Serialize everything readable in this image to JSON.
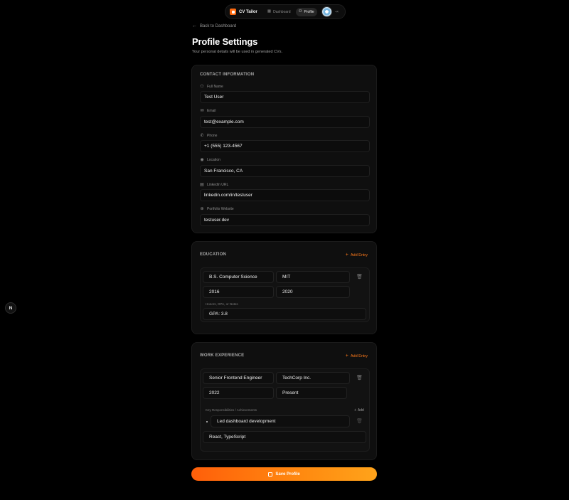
{
  "nav": {
    "brand": "CV Tailor",
    "items": [
      {
        "label": "Dashboard",
        "icon": "grid-icon",
        "active": false
      },
      {
        "label": "Profile",
        "icon": "user-icon",
        "active": true
      }
    ],
    "logout_glyph": "⇥"
  },
  "side_badge": {
    "letter": "N"
  },
  "header": {
    "back": "Back to Dashboard",
    "title": "Profile Settings",
    "subtitle": "Your personal details will be used in generated CVs."
  },
  "contact": {
    "title": "CONTACT INFORMATION",
    "fields": [
      {
        "label": "Full Name",
        "value": "Test User",
        "icon": "user-icon"
      },
      {
        "label": "Email",
        "value": "test@example.com",
        "icon": "mail-icon"
      },
      {
        "label": "Phone",
        "value": "+1 (555) 123-4567",
        "icon": "phone-icon"
      },
      {
        "label": "Location",
        "value": "San Francisco, CA",
        "icon": "map-pin-icon"
      },
      {
        "label": "LinkedIn URL",
        "value": "linkedin.com/in/testuser",
        "icon": "briefcase-icon"
      },
      {
        "label": "Portfolio Website",
        "value": "testuser.dev",
        "icon": "globe-icon"
      }
    ]
  },
  "education": {
    "title": "EDUCATION",
    "add_label": "Add Entry",
    "entry": {
      "degree": "B.S. Computer Science",
      "school": "MIT",
      "start": "2016",
      "end": "2020",
      "notes_label": "Honors, GPA, or Notes",
      "notes": "GPA: 3.8"
    }
  },
  "work": {
    "title": "WORK EXPERIENCE",
    "add_label": "Add Entry",
    "entry": {
      "role": "Senior Frontend Engineer",
      "company": "TechCorp Inc.",
      "start": "2022",
      "end": "Present",
      "resp_label": "Key Responsibilities / Achievements",
      "add_label": "Add",
      "bullet": "Led dashboard development",
      "tech": "React, TypeScript"
    }
  },
  "save": {
    "label": "Save Profile"
  },
  "colors": {
    "accent": "#ff6a10",
    "background": "#000000",
    "card": "#0f0f0f"
  }
}
